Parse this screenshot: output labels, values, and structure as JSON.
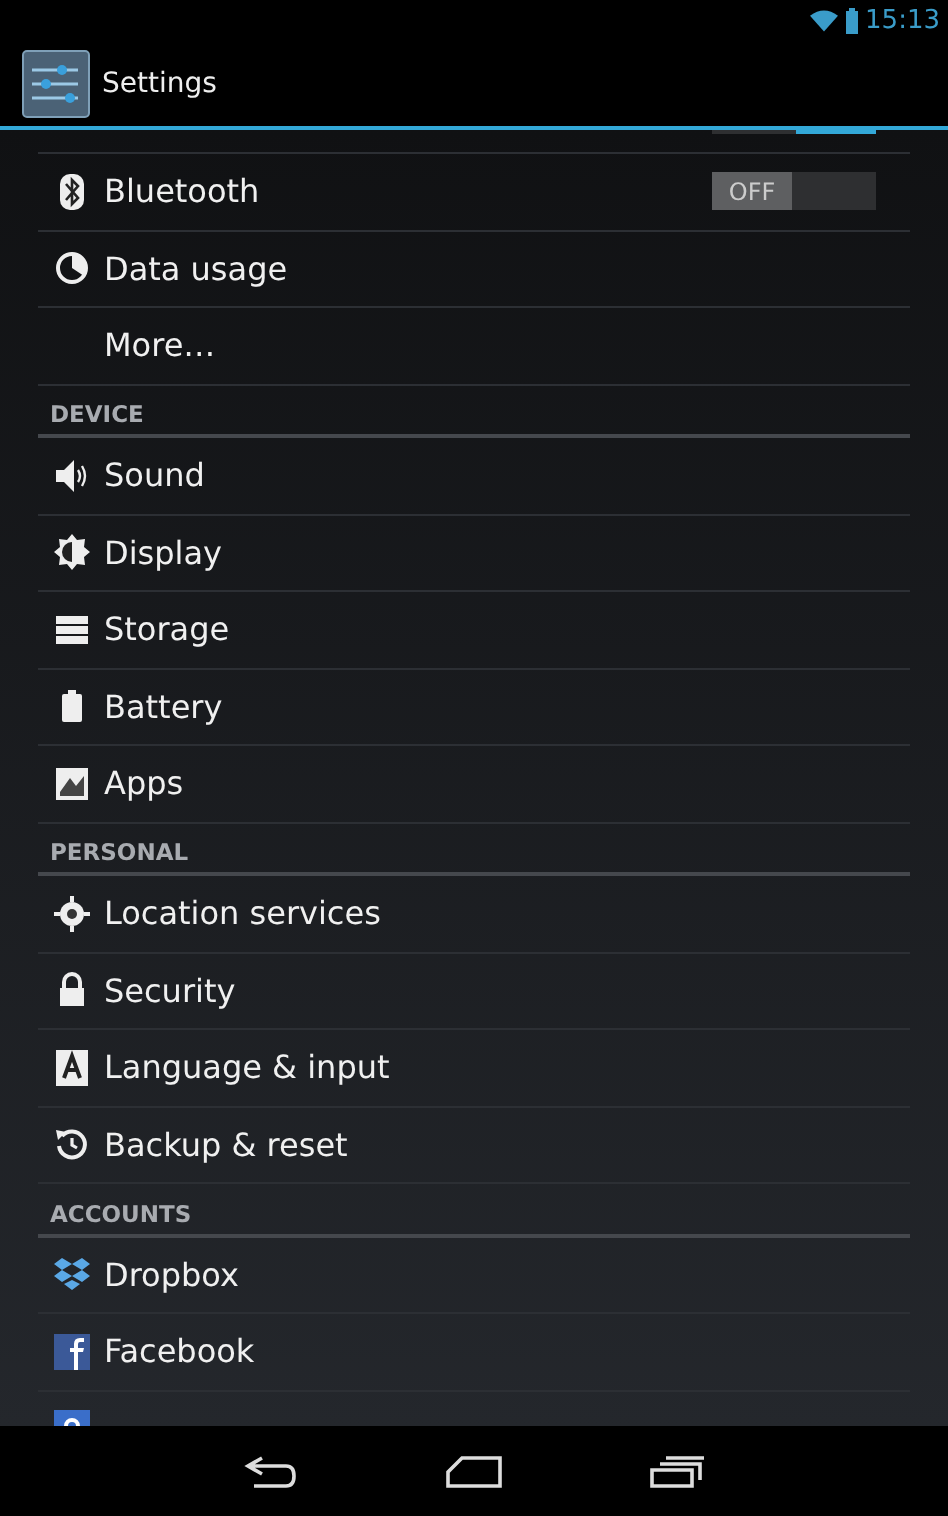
{
  "status_bar": {
    "time": "15:13"
  },
  "action_bar": {
    "title": "Settings"
  },
  "items": [
    {
      "kind": "switch",
      "on": true
    },
    {
      "kind": "switch",
      "label": "Bluetooth",
      "on": false,
      "switch_label": "OFF"
    },
    {
      "kind": "item",
      "label": "Data usage"
    },
    {
      "kind": "item",
      "label": "More…"
    },
    {
      "kind": "header",
      "label": "DEVICE"
    },
    {
      "kind": "item",
      "label": "Sound"
    },
    {
      "kind": "item",
      "label": "Display"
    },
    {
      "kind": "item",
      "label": "Storage"
    },
    {
      "kind": "item",
      "label": "Battery"
    },
    {
      "kind": "item",
      "label": "Apps"
    },
    {
      "kind": "header",
      "label": "PERSONAL"
    },
    {
      "kind": "item",
      "label": "Location services"
    },
    {
      "kind": "item",
      "label": "Security"
    },
    {
      "kind": "item",
      "label": "Language & input"
    },
    {
      "kind": "item",
      "label": "Backup & reset"
    },
    {
      "kind": "header",
      "label": "ACCOUNTS"
    },
    {
      "kind": "item",
      "label": "Dropbox"
    },
    {
      "kind": "item",
      "label": "Facebook"
    },
    {
      "kind": "item"
    }
  ]
}
